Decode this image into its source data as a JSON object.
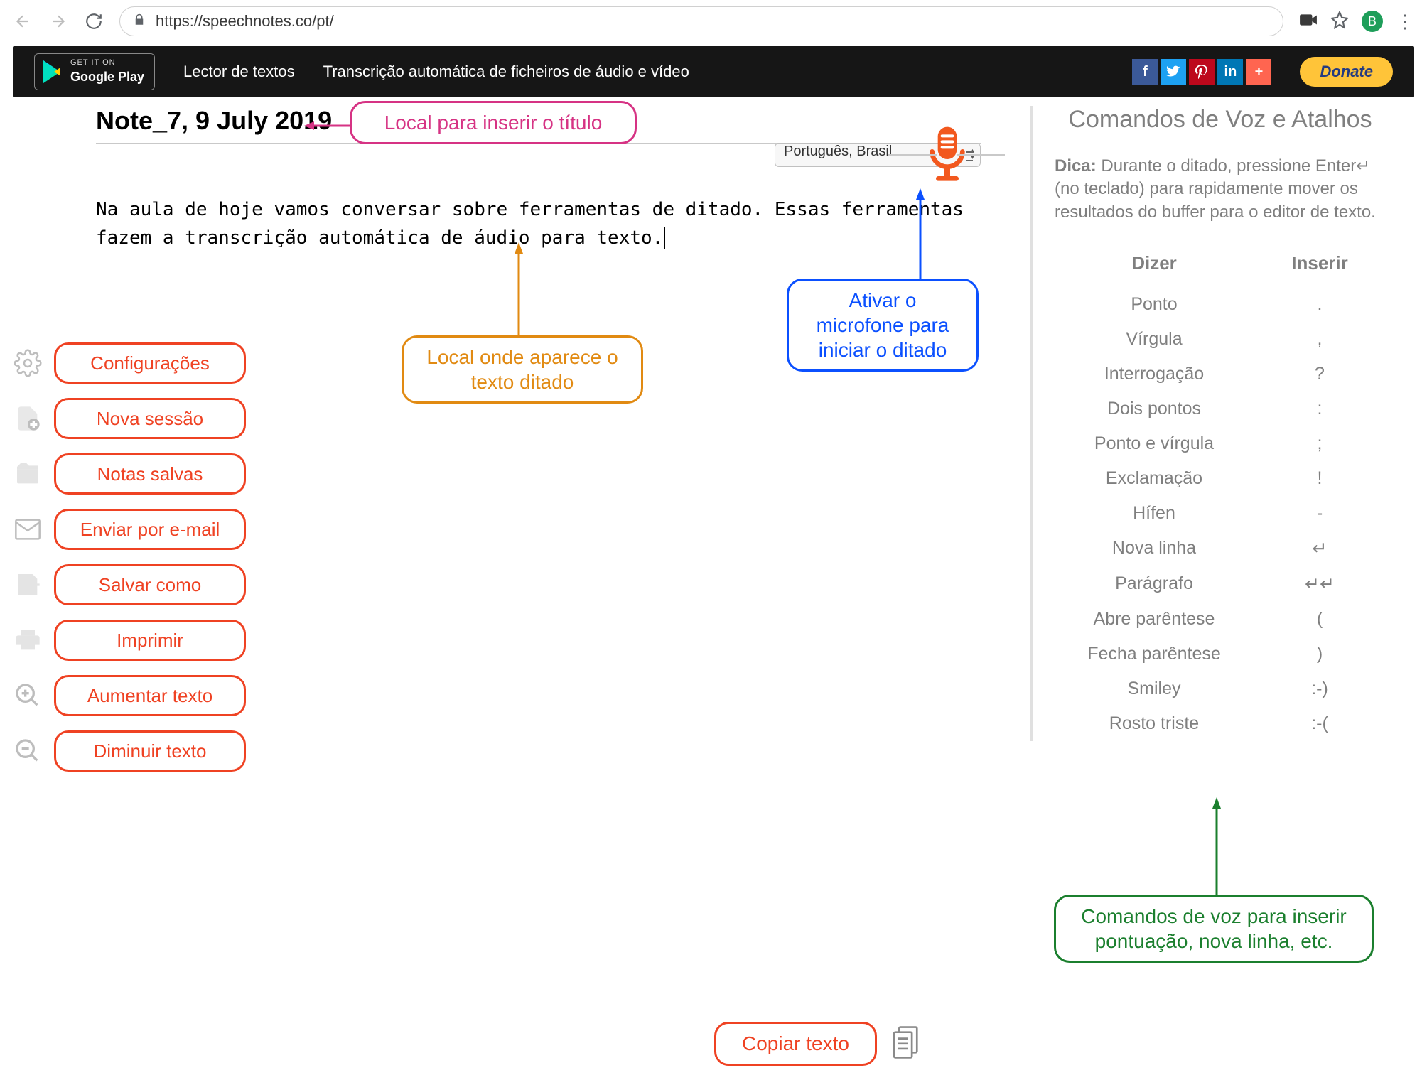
{
  "browser": {
    "url": "https://speechnotes.co/pt/",
    "avatar_letter": "B"
  },
  "topbar": {
    "gplay_small": "GET IT ON",
    "gplay_big": "Google Play",
    "link1": "Lector de textos",
    "link2": "Transcrição automática de ficheiros de áudio e vídeo",
    "donate": "Donate"
  },
  "editor": {
    "title": "Note_7, 9 July 2019",
    "language": "Português, Brasil",
    "body": "Na aula de hoje vamos conversar sobre ferramentas de ditado. Essas ferramentas fazem a transcrição automática de áudio para texto."
  },
  "sidebar": {
    "items": [
      "Configurações",
      "Nova sessão",
      "Notas salvas",
      "Enviar por e-mail",
      "Salvar como",
      "Imprimir",
      "Aumentar texto",
      "Diminuir texto"
    ]
  },
  "copy_button": "Copiar texto",
  "rightpanel": {
    "title": "Comandos de Voz e Atalhos",
    "tip_label": "Dica:",
    "tip_text": " Durante o ditado, pressione Enter↵ (no teclado) para rapidamente mover os resultados do buffer para o editor de texto.",
    "col1": "Dizer",
    "col2": "Inserir",
    "commands": [
      {
        "say": "Ponto",
        "ins": "."
      },
      {
        "say": "Vírgula",
        "ins": ","
      },
      {
        "say": "Interrogação",
        "ins": "?"
      },
      {
        "say": "Dois pontos",
        "ins": ":"
      },
      {
        "say": "Ponto e vírgula",
        "ins": ";"
      },
      {
        "say": "Exclamação",
        "ins": "!"
      },
      {
        "say": "Hífen",
        "ins": "-"
      },
      {
        "say": "Nova linha",
        "ins": "↵"
      },
      {
        "say": "Parágrafo",
        "ins": "↵↵"
      },
      {
        "say": "Abre parêntese",
        "ins": "("
      },
      {
        "say": "Fecha parêntese",
        "ins": ")"
      },
      {
        "say": "Smiley",
        "ins": ":-)"
      },
      {
        "say": "Rosto triste",
        "ins": ":-("
      }
    ]
  },
  "annotations": {
    "title_callout": "Local para inserir o título",
    "text_callout": "Local onde aparece o texto ditado",
    "mic_callout": "Ativar o microfone para iniciar o ditado",
    "commands_callout": "Comandos de voz para inserir pontuação, nova linha, etc."
  }
}
